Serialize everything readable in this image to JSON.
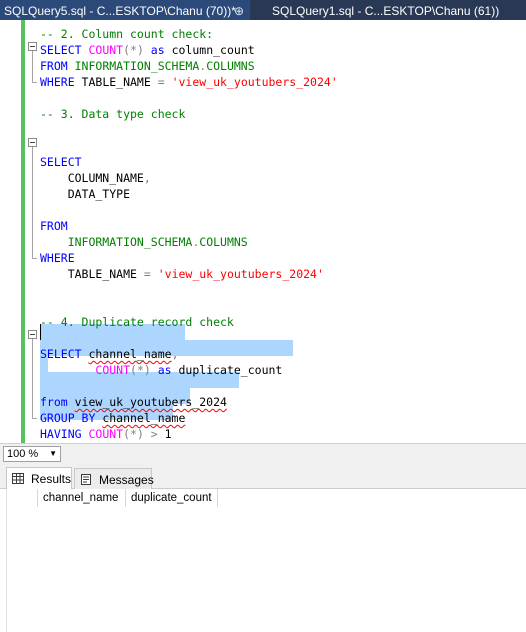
{
  "tabs": [
    {
      "label": "SQLQuery5.sql - C...ESKTOP\\Chanu (70))*",
      "active": true
    },
    {
      "label": "SQLQuery1.sql - C...ESKTOP\\Chanu (61))",
      "active": false
    }
  ],
  "pin_icon": "⊕",
  "editor": {
    "lines": [
      {
        "tokens": [
          {
            "t": "-- 2. Column count check:",
            "c": "cm"
          }
        ]
      },
      {
        "tokens": [
          {
            "t": "SELECT ",
            "c": "kw"
          },
          {
            "t": "COUNT",
            "c": "fn"
          },
          {
            "t": "(*)",
            "c": "op"
          },
          {
            "t": " as ",
            "c": "kw"
          },
          {
            "t": "column_count",
            "c": ""
          }
        ]
      },
      {
        "tokens": [
          {
            "t": "FROM ",
            "c": "kw"
          },
          {
            "t": "INFORMATION_SCHEMA",
            "c": "obj"
          },
          {
            "t": ".",
            "c": "op"
          },
          {
            "t": "COLUMNS",
            "c": "obj"
          }
        ]
      },
      {
        "tokens": [
          {
            "t": "WHERE ",
            "c": "kw"
          },
          {
            "t": "TABLE_NAME ",
            "c": ""
          },
          {
            "t": "= ",
            "c": "op"
          },
          {
            "t": "'view_uk_youtubers_2024'",
            "c": "str"
          }
        ]
      },
      {
        "tokens": []
      },
      {
        "tokens": [
          {
            "t": "-- 3. Data type check",
            "c": "cm"
          }
        ]
      },
      {
        "tokens": []
      },
      {
        "tokens": []
      },
      {
        "tokens": [
          {
            "t": "SELECT",
            "c": "kw"
          }
        ]
      },
      {
        "tokens": [
          {
            "t": "    COLUMN_NAME",
            "c": ""
          },
          {
            "t": ",",
            "c": "op"
          }
        ]
      },
      {
        "tokens": [
          {
            "t": "    DATA_TYPE",
            "c": ""
          }
        ]
      },
      {
        "tokens": []
      },
      {
        "tokens": [
          {
            "t": "FROM",
            "c": "kw"
          }
        ]
      },
      {
        "tokens": [
          {
            "t": "    INFORMATION_SCHEMA",
            "c": "obj"
          },
          {
            "t": ".",
            "c": "op"
          },
          {
            "t": "COLUMNS",
            "c": "obj"
          }
        ]
      },
      {
        "tokens": [
          {
            "t": "WHERE",
            "c": "kw"
          }
        ]
      },
      {
        "tokens": [
          {
            "t": "    TABLE_NAME ",
            "c": ""
          },
          {
            "t": "= ",
            "c": "op"
          },
          {
            "t": "'view_uk_youtubers_2024'",
            "c": "str"
          }
        ]
      },
      {
        "tokens": []
      },
      {
        "tokens": []
      },
      {
        "tokens": [
          {
            "t": "-- 4. Duplicate record check",
            "c": "cm"
          }
        ]
      },
      {
        "tokens": []
      },
      {
        "tokens": [
          {
            "t": "SELECT ",
            "c": "kw"
          },
          {
            "t": "channel_name",
            "c": "sq"
          },
          {
            "t": ",",
            "c": "op"
          }
        ]
      },
      {
        "tokens": [
          {
            "t": "        ",
            "c": ""
          },
          {
            "t": "COUNT",
            "c": "fn"
          },
          {
            "t": "(*)",
            "c": "op"
          },
          {
            "t": " as ",
            "c": "kw"
          },
          {
            "t": "duplicate_count",
            "c": ""
          }
        ]
      },
      {
        "tokens": []
      },
      {
        "tokens": [
          {
            "t": "from ",
            "c": "kw"
          },
          {
            "t": "view_uk_youtubers_2024",
            "c": "sq"
          }
        ]
      },
      {
        "tokens": [
          {
            "t": "GROUP BY ",
            "c": "kw"
          },
          {
            "t": "channel_name",
            "c": "sq"
          }
        ]
      },
      {
        "tokens": [
          {
            "t": "HAVING ",
            "c": "kw"
          },
          {
            "t": "COUNT",
            "c": "fn"
          },
          {
            "t": "(*)",
            "c": "op"
          },
          {
            "t": " > ",
            "c": "op"
          },
          {
            "t": "1",
            "c": ""
          }
        ]
      }
    ]
  },
  "zoom": {
    "value": "100 %"
  },
  "results_tabs": [
    {
      "label": "Results",
      "icon": "grid-icon"
    },
    {
      "label": "Messages",
      "icon": "message-icon"
    }
  ],
  "results_grid": {
    "columns": [
      "channel_name",
      "duplicate_count"
    ]
  }
}
